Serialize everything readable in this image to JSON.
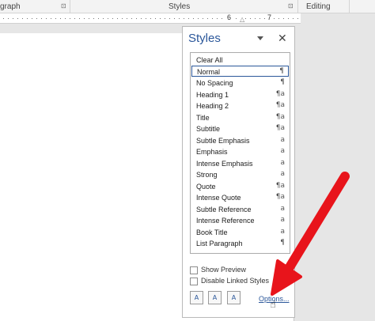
{
  "ribbon": {
    "paragraph_label": "graph",
    "styles_label": "Styles",
    "editing_label": "Editing",
    "launcher_glyph": "⊡"
  },
  "ruler": {
    "numbers": [
      "6",
      "7"
    ]
  },
  "styles_pane": {
    "title": "Styles",
    "menu_icon": "chevron-down-icon",
    "close_glyph": "✕",
    "items": [
      {
        "label": "Clear All",
        "glyph": ""
      },
      {
        "label": "Normal",
        "glyph": "¶"
      },
      {
        "label": "No Spacing",
        "glyph": "¶"
      },
      {
        "label": "Heading 1",
        "glyph": "¶a"
      },
      {
        "label": "Heading 2",
        "glyph": "¶a"
      },
      {
        "label": "Title",
        "glyph": "¶a"
      },
      {
        "label": "Subtitle",
        "glyph": "¶a"
      },
      {
        "label": "Subtle Emphasis",
        "glyph": "a"
      },
      {
        "label": "Emphasis",
        "glyph": "a"
      },
      {
        "label": "Intense Emphasis",
        "glyph": "a"
      },
      {
        "label": "Strong",
        "glyph": "a"
      },
      {
        "label": "Quote",
        "glyph": "¶a"
      },
      {
        "label": "Intense Quote",
        "glyph": "¶a"
      },
      {
        "label": "Subtle Reference",
        "glyph": "a"
      },
      {
        "label": "Intense Reference",
        "glyph": "a"
      },
      {
        "label": "Book Title",
        "glyph": "a"
      },
      {
        "label": "List Paragraph",
        "glyph": "¶"
      }
    ],
    "selected_item": "Normal",
    "show_preview_label": "Show Preview",
    "disable_linked_label": "Disable Linked Styles",
    "options_label": "Options...",
    "new_style_glyph": "A",
    "style_inspector_glyph": "A",
    "manage_styles_glyph": "A"
  },
  "annotation": {
    "arrow_color": "#e8141b"
  }
}
